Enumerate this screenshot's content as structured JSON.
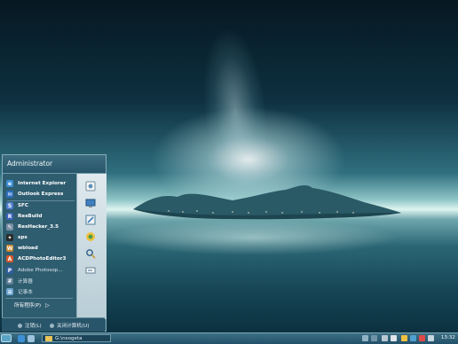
{
  "start_menu": {
    "user": "Administrator",
    "programs": [
      {
        "label": "Internet Explorer",
        "icon": "internet-explorer-icon",
        "color": "#3d8fd6"
      },
      {
        "label": "Outlook Express",
        "icon": "outlook-express-icon",
        "color": "#2f6fc2"
      },
      {
        "label": "SFC",
        "icon": "sfc-icon",
        "color": "#4f7fd0"
      },
      {
        "label": "ResBuild",
        "icon": "resbuild-icon",
        "color": "#3b62b8"
      },
      {
        "label": "ResHacker_3.5",
        "icon": "reshacker-icon",
        "color": "#7a8fa4"
      },
      {
        "label": "sps",
        "icon": "sps-icon",
        "color": "#2a2a2a"
      },
      {
        "label": "wbload",
        "icon": "wbload-icon",
        "color": "#c8862e"
      },
      {
        "label": "ACDPhotoEditor3",
        "icon": "acdphotoeditor-icon",
        "color": "#d4582c"
      },
      {
        "label": "Adobe Photosop...",
        "icon": "adobe-photoshop-icon",
        "color": "#2f5fa0"
      },
      {
        "label": "计算器",
        "icon": "calculator-icon",
        "color": "#5f7f98"
      },
      {
        "label": "记事本",
        "icon": "notepad-icon",
        "color": "#6fa7d2"
      }
    ],
    "all_programs": "所有程序(P)",
    "right_column_icons": [
      "my-documents-icon",
      "my-computer-icon",
      "control-panel-icon",
      "network-icon",
      "search-icon",
      "run-icon"
    ],
    "footer": {
      "logoff": "注销(L)",
      "shutdown": "关闭计算机(U)"
    }
  },
  "taskbar": {
    "window_title": "G:\\nsogeta",
    "clock": "13:32"
  }
}
